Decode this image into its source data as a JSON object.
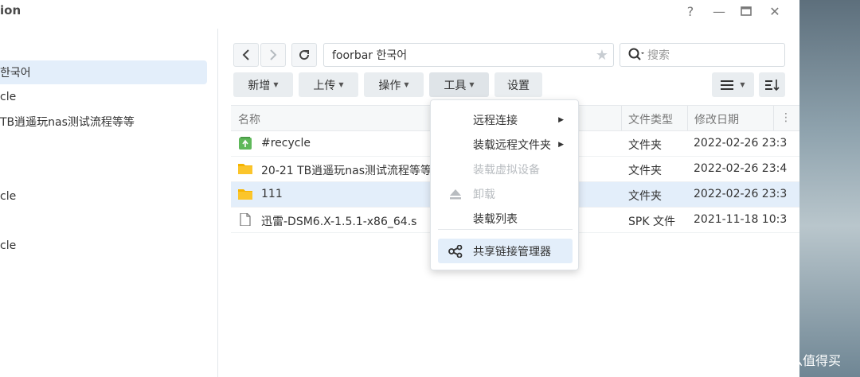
{
  "window": {
    "title": "ion",
    "controls": {
      "help": "?",
      "minimize": "—",
      "maximize": "▭",
      "close": "✕"
    }
  },
  "sidebar": {
    "items": [
      {
        "label": "한국어"
      },
      {
        "label": "cle"
      },
      {
        "label": "TB逍遥玩nas测试流程等等"
      },
      {
        "label": "cle"
      },
      {
        "label": "cle"
      }
    ]
  },
  "toolbar": {
    "path": "foorbar 한국어",
    "search_placeholder": "搜索",
    "buttons": [
      "新增",
      "上传",
      "操作",
      "工具",
      "设置"
    ]
  },
  "columns": {
    "name": "名称",
    "type": "文件类型",
    "modified": "修改日期"
  },
  "files": [
    {
      "name": "#recycle",
      "icon": "recycle-icon",
      "type": "文件夹",
      "modified": "2022-02-26 23:3"
    },
    {
      "name": "20-21 TB逍遥玩nas测试流程等等",
      "icon": "folder-icon",
      "type": "文件夹",
      "modified": "2022-02-26 23:4"
    },
    {
      "name": "111",
      "icon": "folder-icon",
      "type": "文件夹",
      "modified": "2022-02-26 23:3"
    },
    {
      "name": "迅雷-DSM6.X-1.5.1-x86_64.s",
      "icon": "file-icon",
      "type": "SPK 文件",
      "modified": "2021-11-18 10:3"
    }
  ],
  "menu": {
    "items": [
      {
        "label": "远程连接",
        "disabled": false,
        "submenu": true
      },
      {
        "label": "装载远程文件夹",
        "disabled": false,
        "submenu": true
      },
      {
        "label": "装载虚拟设备",
        "disabled": true,
        "submenu": false
      },
      {
        "label": "卸载",
        "disabled": true,
        "submenu": false,
        "icon": "eject-icon"
      },
      {
        "label": "装载列表",
        "disabled": false,
        "submenu": false
      },
      {
        "label": "共享链接管理器",
        "disabled": false,
        "submenu": false,
        "icon": "share-icon",
        "highlighted": true
      }
    ]
  },
  "watermark": {
    "text": "什么值得买",
    "logo": "值"
  },
  "colors": {
    "selection": "#e3eefa",
    "folder": "#f6b400",
    "recycle": "#5fb85a"
  }
}
